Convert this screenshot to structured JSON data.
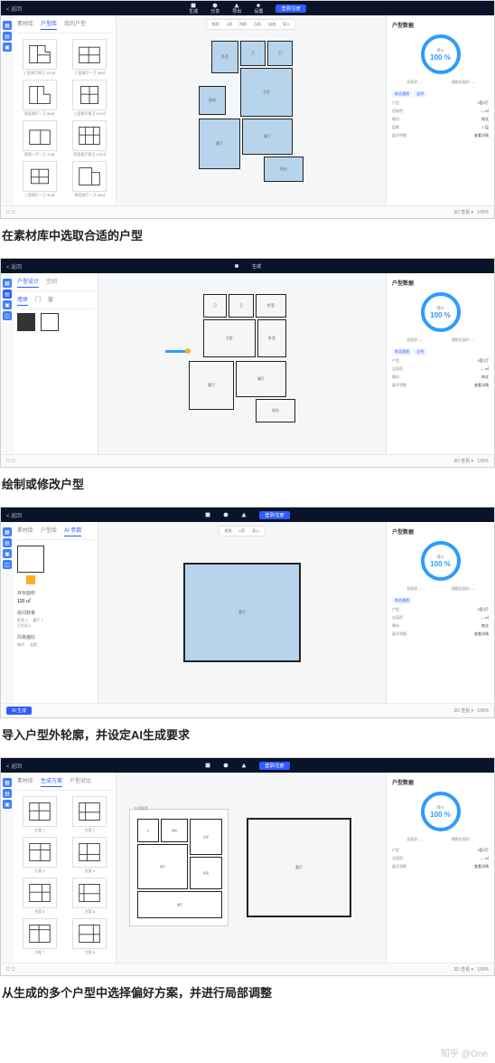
{
  "captions": {
    "s1": "在素材库中选取合适的户型",
    "s2": "绘制或修改户型",
    "s3": "导入户型外轮廓，并设定AI生成要求",
    "s4": "从生成的多个户型中选择偏好方案，并进行局部调整"
  },
  "topbar": {
    "back": "< 返回",
    "items": [
      "生成",
      "分享",
      "导出",
      "设置"
    ],
    "login": "登录/注册"
  },
  "toolbar": {
    "items": [
      "矩形",
      "L形",
      "凹形",
      "凸形",
      "自由",
      "导入"
    ]
  },
  "panel": {
    "tabs": [
      "素材库",
      "户型库",
      "我的户型"
    ],
    "tabs2": [
      "墙体",
      "门",
      "窗"
    ],
    "tabs3": [
      "AI 参数"
    ],
    "active1": "户型库",
    "active2": "墙体",
    "thumbs": [
      "三室两厅两卫 120㎡",
      "三室两厅一卫 98㎡",
      "两室两厅一卫 86㎡",
      "三室两厅两卫 110㎡",
      "两室一厅一卫 72㎡",
      "四室两厅两卫 140㎡",
      "三室两厅一卫 95㎡",
      "两室两厅一卫 80㎡"
    ],
    "s2_tabs_root": [
      "户型设计",
      "空间"
    ],
    "s2_tree": [
      "墙",
      "门",
      "窗"
    ],
    "s3_opts": {
      "area_label": "目标面积",
      "area_value": "120 ㎡",
      "rooms_label": "房间数量",
      "bedrooms": "卧室 3",
      "living": "客厅 1",
      "bath": "卫生间 2",
      "style_label": "风格偏好",
      "style_opts": [
        "现代",
        "北欧"
      ]
    },
    "s4_tabs": [
      "素材库",
      "生成方案",
      "户型对比"
    ],
    "s4_active": "生成方案",
    "s4_section": "方案推荐",
    "s4_thumbs": [
      "方案 1",
      "方案 2",
      "方案 3",
      "方案 4",
      "方案 5",
      "方案 6",
      "方案 7",
      "方案 8"
    ]
  },
  "right": {
    "title": "户型数据",
    "score_label": "得分",
    "score_value": "100 %",
    "stats": {
      "a": "总面积 —",
      "b": "理想总面积 —"
    },
    "props": [
      [
        "户型",
        "3室2厅"
      ],
      [
        "总面积",
        "— ㎡"
      ],
      [
        "朝向",
        "南北"
      ],
      [
        "层数",
        "1 层"
      ]
    ],
    "tags_label": "标签",
    "tags": [
      "南北通透",
      "全明"
    ],
    "deep_label": "展开明细",
    "deep_value": "查看详情"
  },
  "rooms": {
    "bed1": "主卧",
    "bed2": "卧室",
    "bed3": "卧室",
    "living": "客厅",
    "kitchen": "厨房",
    "bath1": "卫",
    "bath2": "卫",
    "balcony": "阳台",
    "dining": "餐厅"
  },
  "footer": {
    "generate": "AI 生成",
    "view": "3D 查看 ▾",
    "zoom": "100%"
  },
  "watermark": "知乎 @One"
}
